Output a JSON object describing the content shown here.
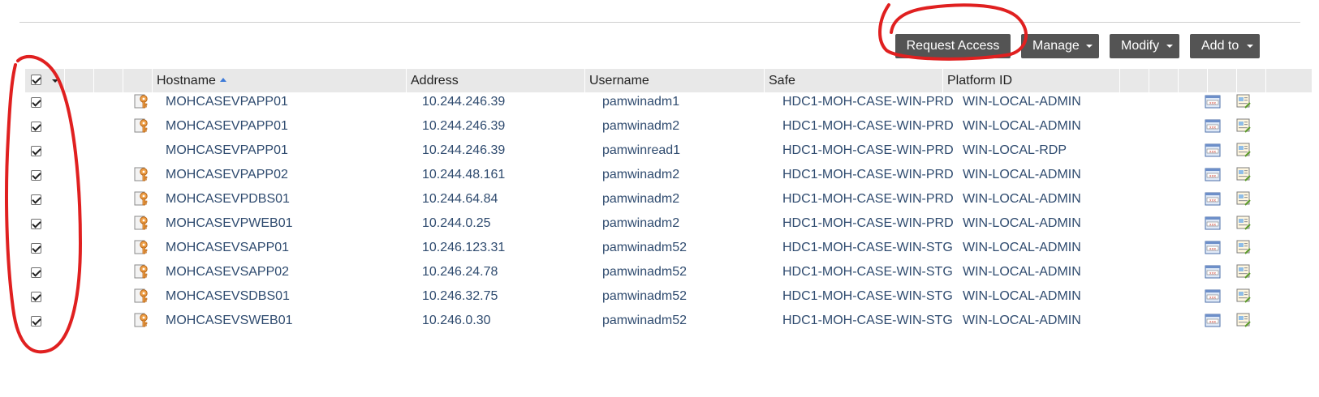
{
  "toolbar": {
    "request_access": "Request Access",
    "manage": "Manage",
    "modify": "Modify",
    "add_to": "Add to"
  },
  "table": {
    "columns": {
      "hostname": "Hostname",
      "address": "Address",
      "username": "Username",
      "safe": "Safe",
      "platform_id": "Platform ID"
    },
    "sort": {
      "column": "Hostname",
      "direction": "ascending"
    },
    "rows": [
      {
        "hostname": "MOHCASEVPAPP01",
        "address": "10.244.246.39",
        "username": "pamwinadm1",
        "safe": "HDC1-MOH-CASE-WIN-PRD",
        "platform": "WIN-LOCAL-ADMIN",
        "has_key": true,
        "checked": true
      },
      {
        "hostname": "MOHCASEVPAPP01",
        "address": "10.244.246.39",
        "username": "pamwinadm2",
        "safe": "HDC1-MOH-CASE-WIN-PRD",
        "platform": "WIN-LOCAL-ADMIN",
        "has_key": true,
        "checked": true
      },
      {
        "hostname": "MOHCASEVPAPP01",
        "address": "10.244.246.39",
        "username": "pamwinread1",
        "safe": "HDC1-MOH-CASE-WIN-PRD",
        "platform": "WIN-LOCAL-RDP",
        "has_key": false,
        "checked": true
      },
      {
        "hostname": "MOHCASEVPAPP02",
        "address": "10.244.48.161",
        "username": "pamwinadm2",
        "safe": "HDC1-MOH-CASE-WIN-PRD",
        "platform": "WIN-LOCAL-ADMIN",
        "has_key": true,
        "checked": true
      },
      {
        "hostname": "MOHCASEVPDBS01",
        "address": "10.244.64.84",
        "username": "pamwinadm2",
        "safe": "HDC1-MOH-CASE-WIN-PRD",
        "platform": "WIN-LOCAL-ADMIN",
        "has_key": true,
        "checked": true
      },
      {
        "hostname": "MOHCASEVPWEB01",
        "address": "10.244.0.25",
        "username": "pamwinadm2",
        "safe": "HDC1-MOH-CASE-WIN-PRD",
        "platform": "WIN-LOCAL-ADMIN",
        "has_key": true,
        "checked": true
      },
      {
        "hostname": "MOHCASEVSAPP01",
        "address": "10.246.123.31",
        "username": "pamwinadm52",
        "safe": "HDC1-MOH-CASE-WIN-STG",
        "platform": "WIN-LOCAL-ADMIN",
        "has_key": true,
        "checked": true
      },
      {
        "hostname": "MOHCASEVSAPP02",
        "address": "10.246.24.78",
        "username": "pamwinadm52",
        "safe": "HDC1-MOH-CASE-WIN-STG",
        "platform": "WIN-LOCAL-ADMIN",
        "has_key": true,
        "checked": true
      },
      {
        "hostname": "MOHCASEVSDBS01",
        "address": "10.246.32.75",
        "username": "pamwinadm52",
        "safe": "HDC1-MOH-CASE-WIN-STG",
        "platform": "WIN-LOCAL-ADMIN",
        "has_key": true,
        "checked": true
      },
      {
        "hostname": "MOHCASEVSWEB01",
        "address": "10.246.0.30",
        "username": "pamwinadm52",
        "safe": "HDC1-MOH-CASE-WIN-STG",
        "platform": "WIN-LOCAL-ADMIN",
        "has_key": true,
        "checked": true
      }
    ]
  },
  "icons": {
    "key": "key-icon",
    "connect": "connect-icon",
    "details": "account-details-icon",
    "sort": "sort-ascending-icon"
  },
  "colors": {
    "button_bg": "#545454",
    "header_bg": "#e8e8e8",
    "link_text": "#2f4b6f",
    "annotation": "#e02020",
    "key_orange": "#e98b2a"
  }
}
